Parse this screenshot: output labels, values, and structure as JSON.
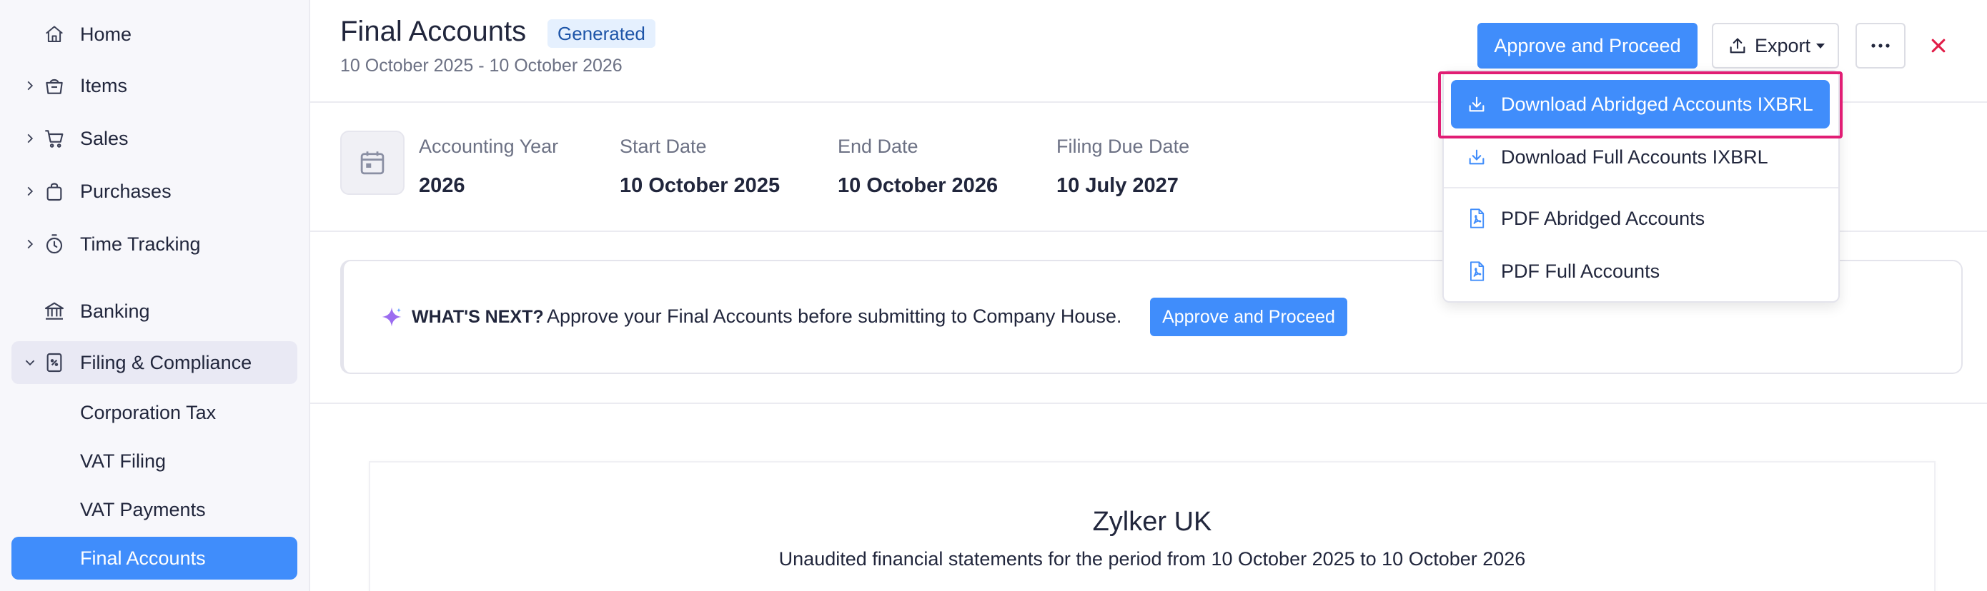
{
  "sidebar": {
    "items": [
      {
        "label": "Home",
        "icon": "home-icon"
      },
      {
        "label": "Items",
        "icon": "basket-icon"
      },
      {
        "label": "Sales",
        "icon": "cart-icon"
      },
      {
        "label": "Purchases",
        "icon": "bag-icon"
      },
      {
        "label": "Time Tracking",
        "icon": "stopwatch-icon"
      },
      {
        "label": "Banking",
        "icon": "bank-icon"
      },
      {
        "label": "Filing & Compliance",
        "icon": "filing-icon"
      }
    ],
    "subitems": [
      {
        "label": "Corporation Tax"
      },
      {
        "label": "VAT Filing"
      },
      {
        "label": "VAT Payments"
      },
      {
        "label": "Final Accounts"
      }
    ]
  },
  "header": {
    "title": "Final Accounts",
    "status_badge": "Generated",
    "period": "10 October 2025 - 10 October 2026",
    "approve_label": "Approve and Proceed",
    "export_label": "Export"
  },
  "summary": {
    "fields": [
      {
        "label": "Accounting Year",
        "value": "2026"
      },
      {
        "label": "Start Date",
        "value": "10 October 2025"
      },
      {
        "label": "End Date",
        "value": "10 October 2026"
      },
      {
        "label": "Filing Due Date",
        "value": "10 July 2027"
      }
    ]
  },
  "whats_next": {
    "title": "WHAT'S NEXT?",
    "text": "Approve your Final Accounts before submitting to Company House.",
    "button_label": "Approve and Proceed"
  },
  "report": {
    "company": "Zylker UK",
    "statement": "Unaudited financial statements for the period from 10 October 2025 to 10 October 2026"
  },
  "export_menu": {
    "items": [
      {
        "label": "Download Abridged Accounts IXBRL",
        "icon": "download-icon"
      },
      {
        "label": "Download Full Accounts IXBRL",
        "icon": "download-icon"
      },
      {
        "label": "PDF Abridged Accounts",
        "icon": "pdf-icon"
      },
      {
        "label": "PDF Full Accounts",
        "icon": "pdf-icon"
      }
    ]
  },
  "colors": {
    "accent": "#408dfb",
    "highlight_frame": "#e11d74",
    "close": "#e11d48",
    "sidebar_bg": "#f7f7fb",
    "badge_bg": "#e5f0fe"
  }
}
